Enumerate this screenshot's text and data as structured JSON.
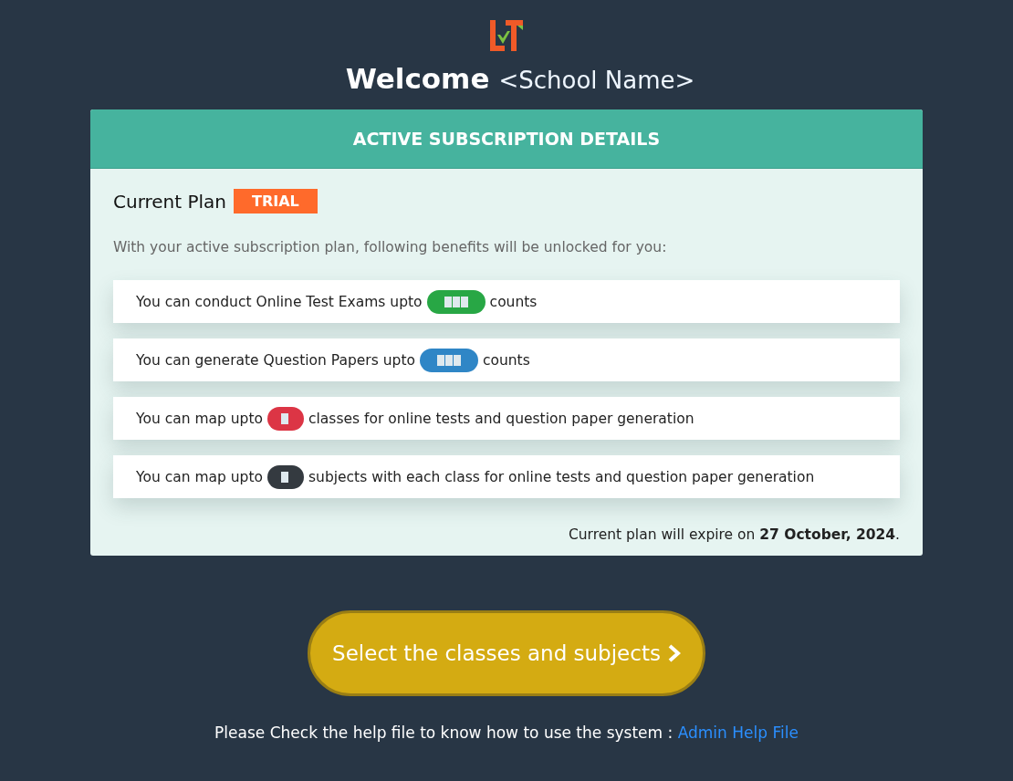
{
  "welcome": {
    "title": "Welcome",
    "school": "<School Name>"
  },
  "card": {
    "header": "ACTIVE SUBSCRIPTION DETAILS",
    "plan_label": "Current Plan",
    "plan_badge": "TRIAL",
    "intro": "With your active subscription plan, following benefits will be unlocked for you:",
    "benefits": [
      {
        "before": "You can conduct Online Test Exams upto",
        "after": "counts",
        "color": "#28a745"
      },
      {
        "before": "You can generate Question Papers upto",
        "after": "counts",
        "color": "#2f86c6"
      },
      {
        "before": "You can map upto",
        "after": "classes for online tests and question paper generation",
        "color": "#dc3545"
      },
      {
        "before": "You can map upto",
        "after": "subjects with each class for online tests and question paper generation",
        "color": "#343a40"
      }
    ],
    "expiry": "Current plan will expire on **27 October, 2024**."
  },
  "action_button": {
    "label": "Select the classes and subjects"
  },
  "footer": {
    "text": "Please Check the help file to know how to use the system :",
    "link": "Admin Help File"
  }
}
